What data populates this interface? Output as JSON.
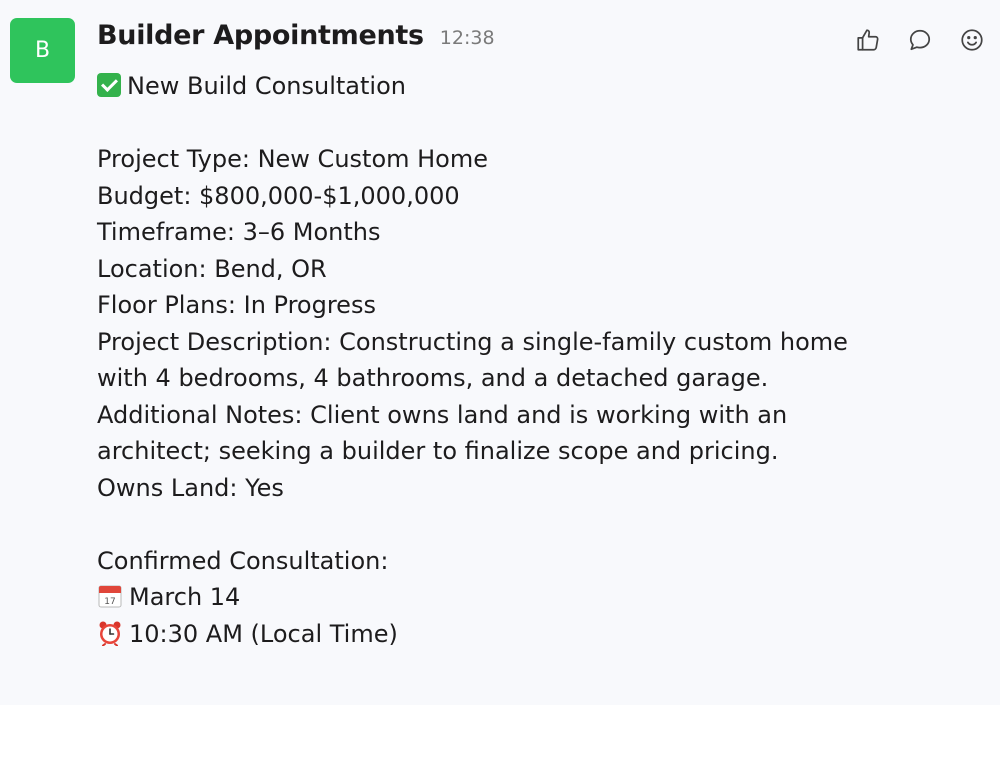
{
  "message": {
    "avatar_letter": "B",
    "avatar_color": "#2fc45c",
    "sender": "Builder Appointments",
    "time": "12:38",
    "actions": [
      "thumbs-up-icon",
      "comment-icon",
      "emoji-icon"
    ],
    "title": "New Build Consultation",
    "title_icon": "check-mark-emoji",
    "lines": {
      "project_type": "Project Type: New Custom Home",
      "budget": "Budget: $800,000-$1,000,000",
      "timeframe": "Timeframe: 3–6 Months",
      "location": "Location: Bend, OR",
      "floor_plans": "Floor Plans: In Progress",
      "description": "Project Description: Constructing a single-family custom home with 4 bedrooms, 4 bathrooms, and a detached garage.",
      "notes": "Additional Notes: Client owns land and is working with an architect; seeking a builder to finalize scope and pricing.",
      "owns_land": "Owns Land: Yes"
    },
    "confirmed_label": "Confirmed Consultation:",
    "date": "March 14",
    "date_icon": "calendar-emoji",
    "time_slot": "10:30 AM (Local Time)",
    "time_icon": "alarm-clock-emoji"
  }
}
